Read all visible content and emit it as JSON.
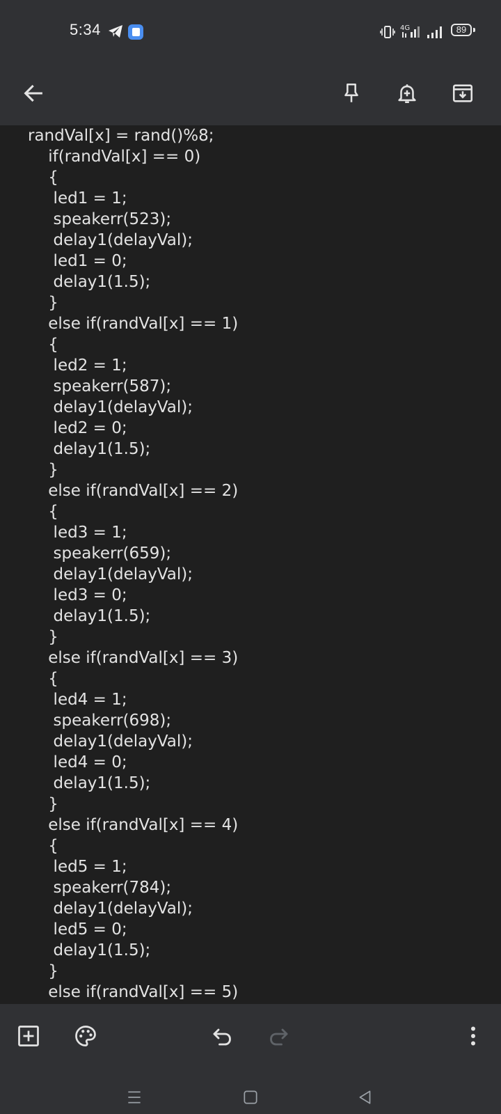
{
  "status_bar": {
    "time": "5:34",
    "battery_level": "89",
    "network_label": "4G"
  },
  "toolbar": {
    "back_icon": "arrow-left-icon",
    "pin_icon": "pin-icon",
    "reminder_icon": "bell-plus-icon",
    "archive_icon": "archive-icon"
  },
  "note": {
    "code": "randVal[x] = rand()%8;\n    if(randVal[x] == 0)\n    {\n     led1 = 1;\n     speakerr(523);\n     delay1(delayVal);\n     led1 = 0;\n     delay1(1.5);\n    }\n    else if(randVal[x] == 1)\n    {\n     led2 = 1;\n     speakerr(587);\n     delay1(delayVal);\n     led2 = 0;\n     delay1(1.5);\n    }\n    else if(randVal[x] == 2)\n    {\n     led3 = 1;\n     speakerr(659);\n     delay1(delayVal);\n     led3 = 0;\n     delay1(1.5);\n    }\n    else if(randVal[x] == 3)\n    {\n     led4 = 1;\n     speakerr(698);\n     delay1(delayVal);\n     led4 = 0;\n     delay1(1.5);\n    }\n    else if(randVal[x] == 4)\n    {\n     led5 = 1;\n     speakerr(784);\n     delay1(delayVal);\n     led5 = 0;\n     delay1(1.5);\n    }\n    else if(randVal[x] == 5)\n    {"
  },
  "bottom_bar": {
    "add_icon": "add-box-icon",
    "palette_icon": "palette-icon",
    "undo_icon": "undo-icon",
    "redo_icon": "redo-icon",
    "more_icon": "more-vert-icon"
  },
  "colors": {
    "bar_background": "#303134",
    "note_background": "#1f1f1f",
    "text": "#e3e3e3",
    "icon": "#e3e3e3",
    "disabled_icon": "#5f6368"
  }
}
